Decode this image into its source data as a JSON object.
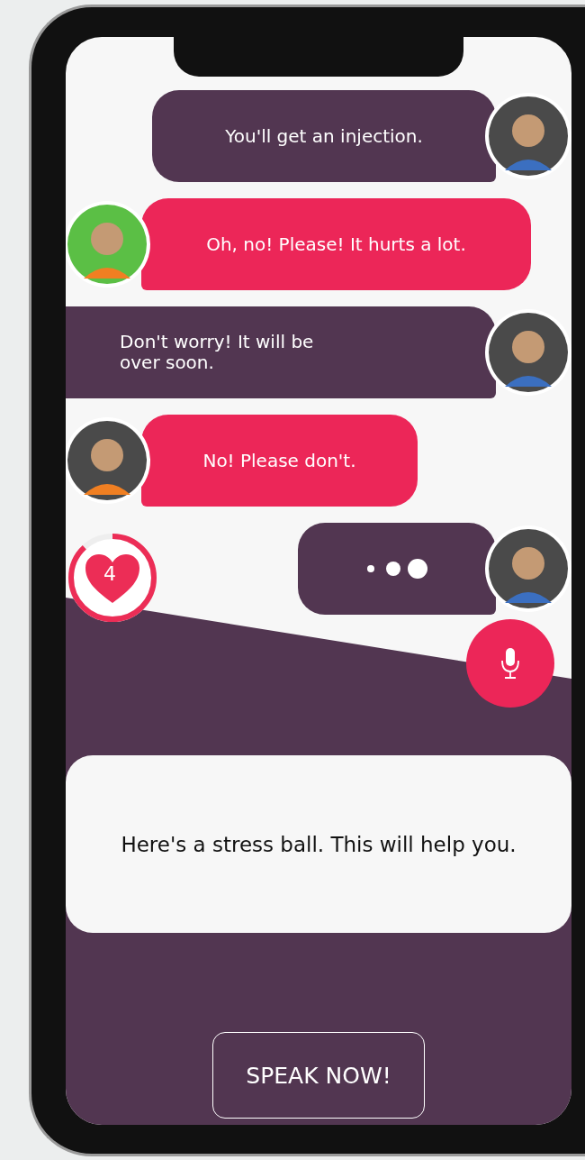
{
  "messages": [
    {
      "kind": "nurse",
      "text": "You'll get an injection.",
      "color": "#4a4a4a"
    },
    {
      "kind": "patient",
      "text": "Oh, no! Please! It hurts a lot.",
      "color": "#5bbf45"
    },
    {
      "kind": "nurse",
      "text": "Don't worry! It will be over soon.",
      "color": "#4a4a4a"
    },
    {
      "kind": "patient",
      "text": "No! Please don't.",
      "color": "#4a4a4a"
    },
    {
      "kind": "typing",
      "color": "#4a4a4a"
    }
  ],
  "lives": {
    "count": "4",
    "level": 0.88
  },
  "prompt": {
    "text": "Here's a stress ball. This will help you."
  },
  "speak_button": {
    "label": "SPEAK NOW!"
  }
}
